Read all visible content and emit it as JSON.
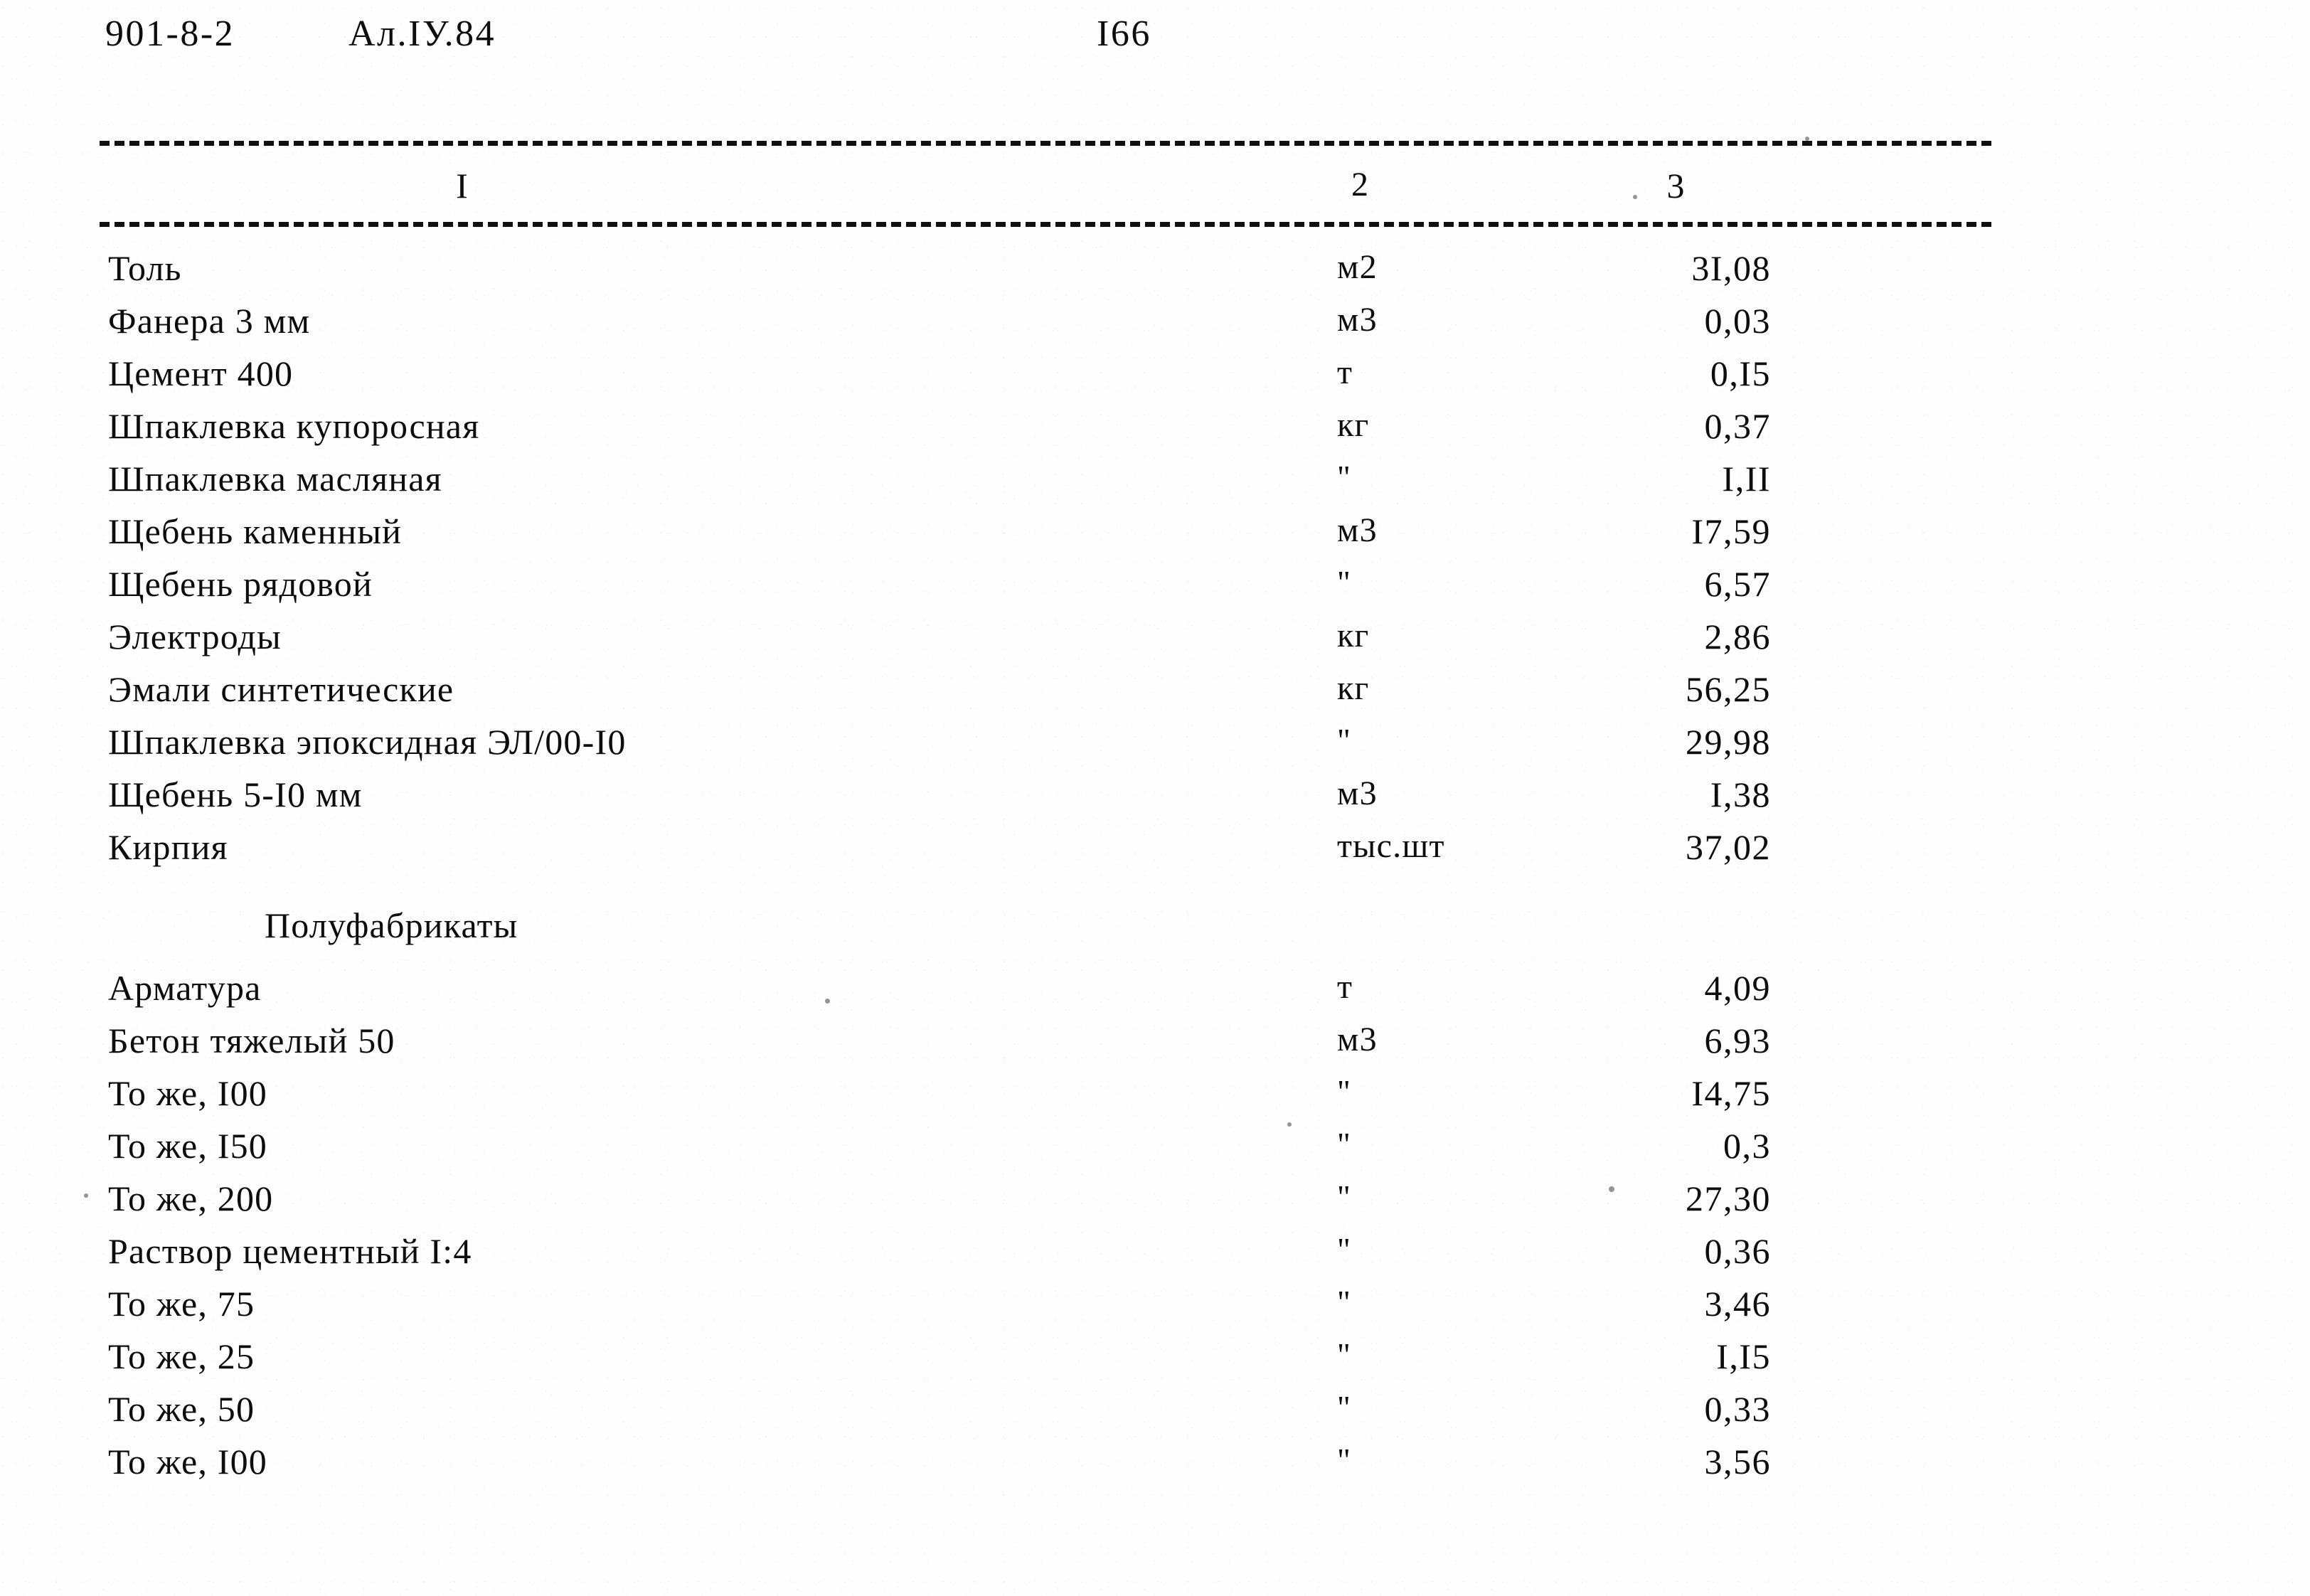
{
  "header": {
    "document_code": "901-8-2",
    "album": "Ал.IУ.84",
    "page_number": "I66"
  },
  "table": {
    "column_headers": {
      "name": "I",
      "unit": "2",
      "value": "3"
    },
    "rows": [
      {
        "name": "Толь",
        "unit": "м2",
        "value": "3I,08"
      },
      {
        "name": "Фанера 3 мм",
        "unit": "м3",
        "value": "0,03"
      },
      {
        "name": "Цемент 400",
        "unit": "т",
        "value": "0,I5"
      },
      {
        "name": "Шпаклевка купоросная",
        "unit": "кг",
        "value": "0,37"
      },
      {
        "name": "Шпаклевка масляная",
        "unit": "\"",
        "value": "I,II"
      },
      {
        "name": "Щебень каменный",
        "unit": "м3",
        "value": "I7,59"
      },
      {
        "name": "Щебень рядовой",
        "unit": "\"",
        "value": "6,57"
      },
      {
        "name": "Электроды",
        "unit": "кг",
        "value": "2,86"
      },
      {
        "name": "Эмали синтетические",
        "unit": "кг",
        "value": "56,25"
      },
      {
        "name": "Шпаклевка эпоксидная ЭЛ/00-I0",
        "unit": "\"",
        "value": "29,98"
      },
      {
        "name": "Щебень 5-I0 мм",
        "unit": "м3",
        "value": "I,38"
      },
      {
        "name": "Кирпия",
        "unit": "тыс.шт",
        "value": "37,02"
      }
    ],
    "section_heading": "Полуфабрикаты",
    "rows2": [
      {
        "name": "Арматура",
        "unit": "т",
        "value": "4,09"
      },
      {
        "name": "Бетон тяжелый 50",
        "unit": "м3",
        "value": "6,93"
      },
      {
        "name": "То же, I00",
        "unit": "\"",
        "value": "I4,75"
      },
      {
        "name": "То же, I50",
        "unit": "\"",
        "value": "0,3"
      },
      {
        "name": "То же, 200",
        "unit": "\"",
        "value": "27,30"
      },
      {
        "name": "Раствор цементный I:4",
        "unit": "\"",
        "value": "0,36"
      },
      {
        "name": "То же, 75",
        "unit": "\"",
        "value": "3,46"
      },
      {
        "name": "То же, 25",
        "unit": "\"",
        "value": "I,I5"
      },
      {
        "name": "То же, 50",
        "unit": "\"",
        "value": "0,33"
      },
      {
        "name": "То же, I00",
        "unit": "\"",
        "value": "3,56"
      }
    ]
  }
}
